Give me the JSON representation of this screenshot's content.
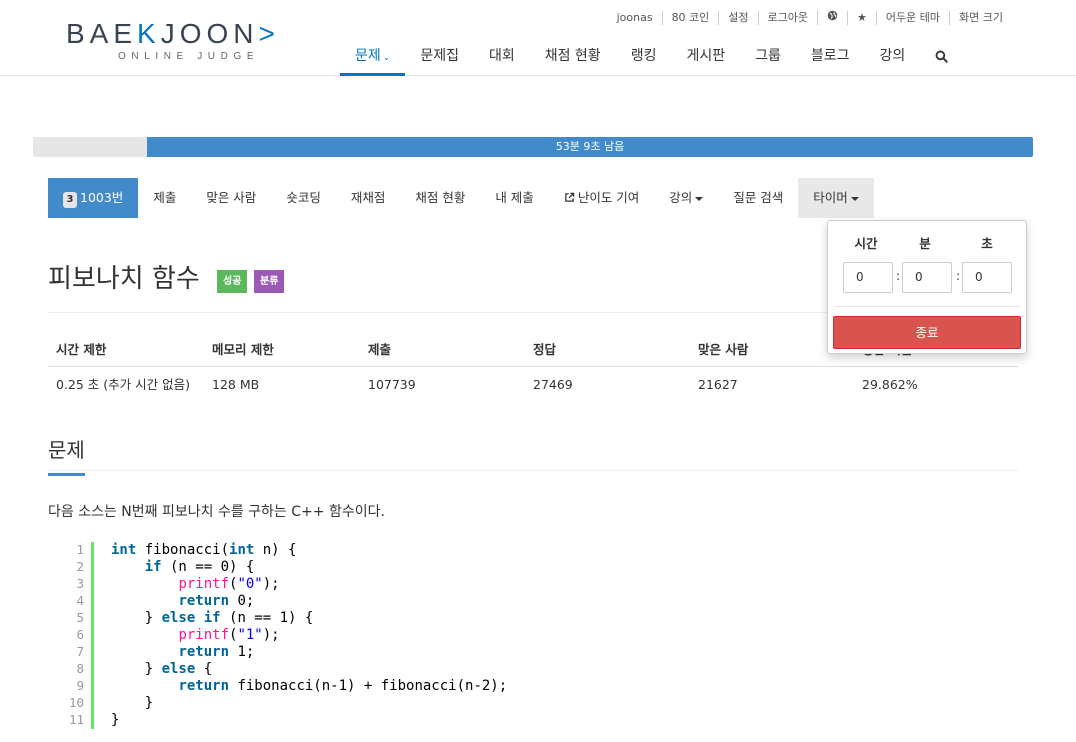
{
  "logo": {
    "main_left": "BAE",
    "main_accent": "K",
    "main_right": "JOON",
    "sub": "ONLINE JUDGE"
  },
  "topbar": [
    "joonas",
    "80 코인",
    "설정",
    "로그아웃",
    "globe-icon",
    "star-icon",
    "어두운 테마",
    "화면 크기"
  ],
  "mainnav": [
    {
      "label": "문제",
      "active": true
    },
    {
      "label": "문제집"
    },
    {
      "label": "대회"
    },
    {
      "label": "채점 현황"
    },
    {
      "label": "랭킹"
    },
    {
      "label": "게시판"
    },
    {
      "label": "그룹"
    },
    {
      "label": "블로그"
    },
    {
      "label": "강의"
    }
  ],
  "progress": {
    "text": "53분 9초 남음",
    "fraction": 0.886
  },
  "tabs": {
    "problem_badge": "3",
    "problem_num": "1003번",
    "submit": "제출",
    "solvers": "맞은 사람",
    "shortcoding": "숏코딩",
    "rejudge": "재채점",
    "status": "채점 현황",
    "my_submit": "내 제출",
    "difficulty": "난이도 기여",
    "lecture": "강의",
    "question": "질문 검색",
    "timer": "타이머"
  },
  "timer": {
    "labels": [
      "시간",
      "분",
      "초"
    ],
    "values": [
      "0",
      "0",
      "0"
    ],
    "separator": ":",
    "end_button": "종료"
  },
  "problem": {
    "title": "피보나치 함수",
    "label_success": "성공",
    "label_class": "분류"
  },
  "info": {
    "headers": [
      "시간 제한",
      "메모리 제한",
      "제출",
      "정답",
      "맞은 사람",
      "정답 비율"
    ],
    "values": [
      "0.25 초 (추가 시간 없음)",
      "128 MB",
      "107739",
      "27469",
      "21627",
      "29.862%"
    ]
  },
  "section": {
    "title": "문제",
    "description": "다음 소스는 N번째 피보나치 수를 구하는 C++ 함수이다."
  },
  "code": {
    "line_numbers": [
      "1",
      "2",
      "3",
      "4",
      "5",
      "6",
      "7",
      "8",
      "9",
      "10",
      "11"
    ],
    "l1_kw": "int",
    "l1_a": " fibonacci(",
    "l1_kw2": "int",
    "l1_b": " n) {",
    "l2_kw": "if",
    "l2_a": " (n == 0) {",
    "l3_fn": "printf",
    "l3_a": "(",
    "l3_str": "\"0\"",
    "l3_b": ");",
    "l4_kw": "return",
    "l4_a": " 0;",
    "l5_a": "} ",
    "l5_kw": "else if",
    "l5_b": " (n == 1) {",
    "l6_fn": "printf",
    "l6_a": "(",
    "l6_str": "\"1\"",
    "l6_b": ");",
    "l7_kw": "return",
    "l7_a": " 1;",
    "l8_a": "} ",
    "l8_kw": "else",
    "l8_b": " {",
    "l9_kw": "return",
    "l9_a": " fibonacci(n-1) + fibonacci(n-2);",
    "l10_a": "}",
    "l11_a": "}"
  }
}
